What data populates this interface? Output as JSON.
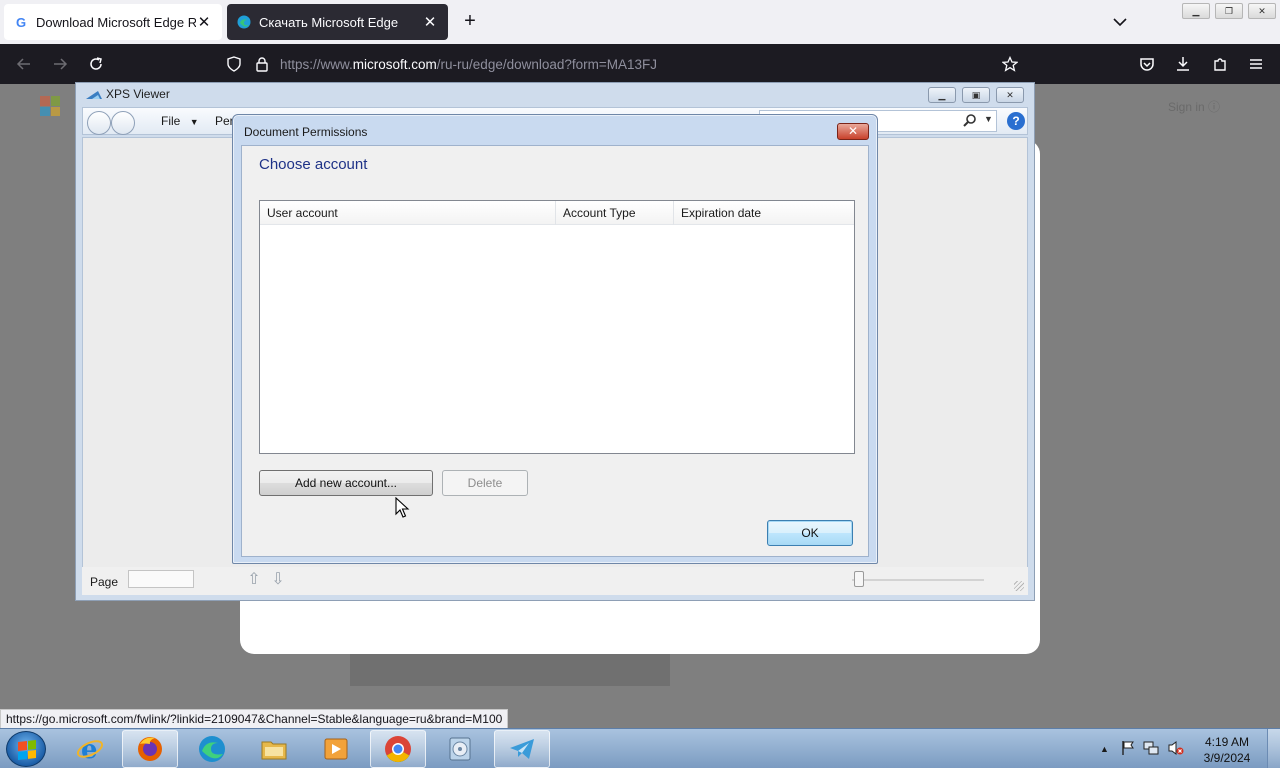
{
  "browser": {
    "tabs": [
      {
        "title": "Download Microsoft Edge Russ",
        "active": false,
        "favicon": "google-g-icon"
      },
      {
        "title": "Скачать Microsoft Edge",
        "active": true,
        "favicon": "edge-icon"
      }
    ],
    "url": {
      "prefix": "https://www.",
      "domain": "microsoft.com",
      "path": "/ru-ru/edge/download?form=MA13FJ"
    },
    "status_link": "https://go.microsoft.com/fwlink/?linkid=2109047&Channel=Stable&language=ru&brand=M100"
  },
  "page_behind": {
    "signin_text": "Sign in ⓘ"
  },
  "xps_viewer": {
    "title": "XPS Viewer",
    "menu": {
      "file": "File",
      "permissions": "Per"
    },
    "status": {
      "page_label": "Page"
    }
  },
  "dialog": {
    "title": "Document Permissions",
    "close_glyph": "✕",
    "heading": "Choose account",
    "columns": [
      "User account",
      "Account Type",
      "Expiration date"
    ],
    "rows": [],
    "buttons": {
      "add": "Add new account...",
      "delete": "Delete",
      "ok": "OK"
    },
    "delete_enabled": false
  },
  "taskbar": {
    "apps": [
      "internet-explorer",
      "firefox",
      "edge-installer",
      "windows-explorer",
      "media-player",
      "chrome",
      "disk-burner",
      "telegram"
    ],
    "clock": {
      "time": "4:19 AM",
      "date": "3/9/2024"
    }
  },
  "colors": {
    "dialog_heading": "#1e3287",
    "ok_button_border": "#3c7fb1",
    "close_button": "#c9412b"
  }
}
